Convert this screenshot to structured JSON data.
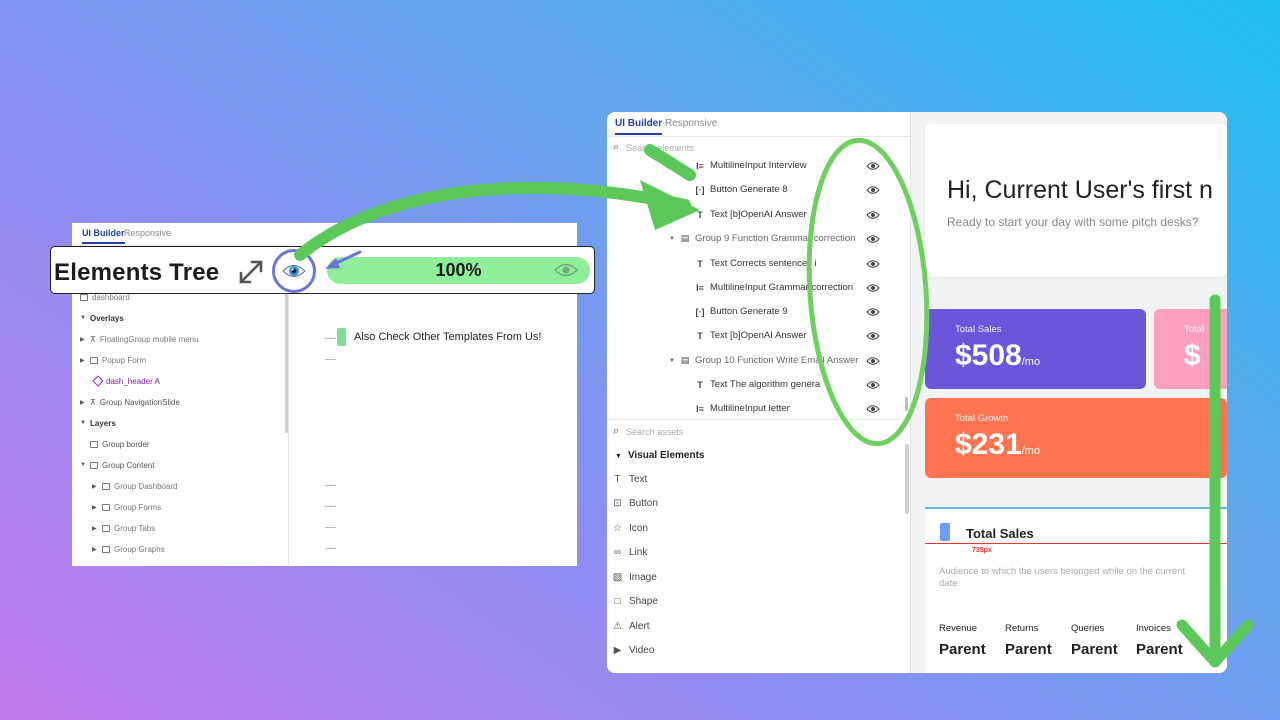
{
  "left_panel": {
    "tabs": [
      "UI Builder",
      "Responsive"
    ],
    "rows": [
      {
        "label": "dashboard"
      },
      {
        "label": "Overlays"
      },
      {
        "label": "FloatingGroup mobile menu"
      },
      {
        "label": "Popup Form"
      },
      {
        "label": "dash_header A"
      },
      {
        "label": "Group NavigationSlide"
      },
      {
        "label": "Layers"
      },
      {
        "label": "Group border"
      },
      {
        "label": "Group Content"
      },
      {
        "label": "Group Dashboard"
      },
      {
        "label": "Group Forms"
      },
      {
        "label": "Group Tabs"
      },
      {
        "label": "Group Graphs"
      }
    ],
    "also_check": "Also Check Other Templates From Us!"
  },
  "tree_header": {
    "title": "Elements Tree",
    "progress": {
      "label": "100%",
      "value": 1.0
    }
  },
  "right_panel": {
    "tabs": [
      "UI Builder",
      "Responsive"
    ],
    "search_elements_placeholder": "Search elements",
    "tree": [
      {
        "label": "MultilineInput Interview",
        "glyph": "I≡"
      },
      {
        "label": "Button Generate 8",
        "glyph": "[·]"
      },
      {
        "label": "Text [b]OpenAI Answer",
        "glyph": "T"
      },
      {
        "label": "Group 9 Function Grammar correction",
        "glyph": "▤"
      },
      {
        "label": "Text Corrects sentences i",
        "glyph": "T"
      },
      {
        "label": "MultilineInput Grammar correction",
        "glyph": "I≡"
      },
      {
        "label": "Button Generate 9",
        "glyph": "[·]"
      },
      {
        "label": "Text [b]OpenAI Answer",
        "glyph": "T"
      },
      {
        "label": "Group 10 Function Write Email Answer",
        "glyph": "▤"
      },
      {
        "label": "Text The algorithm genera",
        "glyph": "T"
      },
      {
        "label": "MultilineInput letter",
        "glyph": "I≡"
      }
    ],
    "search_assets_placeholder": "Search assets",
    "visual_elements_heading": "Visual Elements",
    "assets": [
      {
        "label": "Text",
        "icon": "text-icon"
      },
      {
        "label": "Button",
        "icon": "button-icon"
      },
      {
        "label": "Icon",
        "icon": "star-icon"
      },
      {
        "label": "Link",
        "icon": "link-icon"
      },
      {
        "label": "Image",
        "icon": "image-icon"
      },
      {
        "label": "Shape",
        "icon": "shape-icon"
      },
      {
        "label": "Alert",
        "icon": "alert-icon"
      },
      {
        "label": "Video",
        "icon": "video-icon"
      }
    ]
  },
  "dashboard": {
    "greeting": "Hi, Current User's first n",
    "subtitle": "Ready to start your day with some pitch desks?",
    "stats": [
      {
        "label": "Total Sales",
        "value": "$508",
        "unit": "/mo",
        "color": "#6b55d8"
      },
      {
        "label": "Total",
        "value": "$",
        "unit": "",
        "color": "#ff9fc0"
      },
      {
        "label": "Total Growth",
        "value": "$231",
        "unit": "/mo",
        "color": "#ff7450"
      }
    ],
    "total_sales": {
      "title": "Total Sales",
      "ruler_px": "735px",
      "description": "Audience to which the users belonged while on the current date",
      "columns": [
        {
          "header": "Revenue",
          "value": "Parent"
        },
        {
          "header": "Returns",
          "value": "Parent"
        },
        {
          "header": "Queries",
          "value": "Parent"
        },
        {
          "header": "Invoices",
          "value": "Parent"
        }
      ]
    }
  },
  "colors": {
    "accent_blue": "#1f3fa6",
    "progress_green": "#8eee9a",
    "arrow_green": "#5cc85a",
    "circle_purple": "#6a75d8"
  }
}
